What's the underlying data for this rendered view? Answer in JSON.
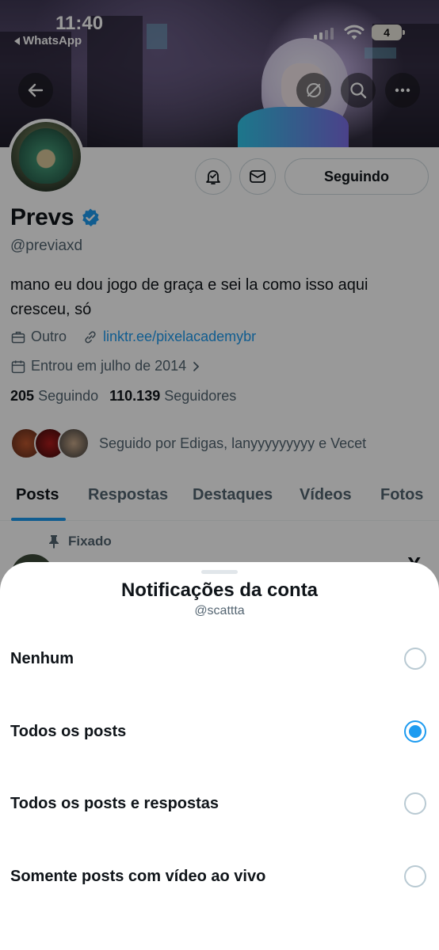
{
  "status_bar": {
    "time": "11:40",
    "back_app": "WhatsApp",
    "battery": "4"
  },
  "header_icons": [
    "back-arrow-icon",
    "grok-icon",
    "search-icon",
    "more-icon"
  ],
  "profile": {
    "name": "Prevs",
    "verified": true,
    "handle": "@previaxd",
    "bio": "mano eu dou jogo de graça e sei la como isso aqui cresceu, só",
    "category": "Outro",
    "link": "linktr.ee/pixelacademybr",
    "joined": "Entrou em julho de 2014",
    "following_count": "205",
    "following_label": "Seguindo",
    "followers_count": "110.139",
    "followers_label": "Seguidores",
    "followed_by": "Seguido por Edigas, lanyyyyyyyyy e Vecet",
    "follow_button": "Seguindo"
  },
  "tabs": [
    {
      "label": "Posts",
      "active": true
    },
    {
      "label": "Respostas",
      "active": false
    },
    {
      "label": "Destaques",
      "active": false
    },
    {
      "label": "Vídeos",
      "active": false
    },
    {
      "label": "Fotos",
      "active": false
    }
  ],
  "pinned_post": {
    "pinned_label": "Fixado"
  },
  "sheet": {
    "title": "Notificações da conta",
    "subtitle": "@scattta",
    "options": [
      {
        "label": "Nenhum",
        "selected": false
      },
      {
        "label": "Todos os posts",
        "selected": true
      },
      {
        "label": "Todos os posts e respostas",
        "selected": false
      },
      {
        "label": "Somente posts com vídeo ao vivo",
        "selected": false
      }
    ]
  },
  "colors": {
    "accent": "#1d9bf0",
    "text": "#0f1419",
    "secondary": "#536471"
  }
}
